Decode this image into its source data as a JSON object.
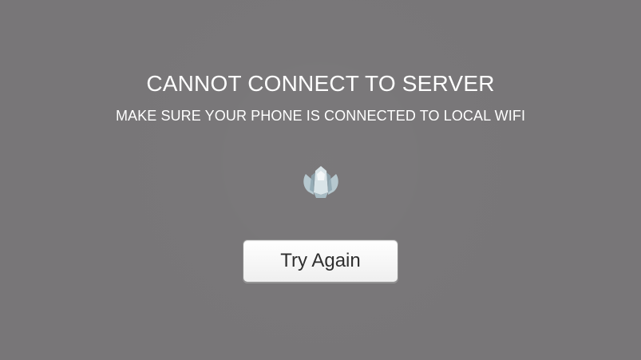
{
  "error": {
    "title": "CANNOT CONNECT TO SERVER",
    "subtitle": "MAKE SURE YOUR PHONE IS CONNECTED TO LOCAL WIFI"
  },
  "logo": {
    "icon": "spaceship-logo-icon",
    "colors": {
      "primary": "#d6e2e7",
      "secondary": "#a9bec7"
    }
  },
  "actions": {
    "try_again_label": "Try Again"
  },
  "theme": {
    "background": "#787678",
    "button_background": "#ffffff",
    "button_text": "#2f2f2f"
  }
}
